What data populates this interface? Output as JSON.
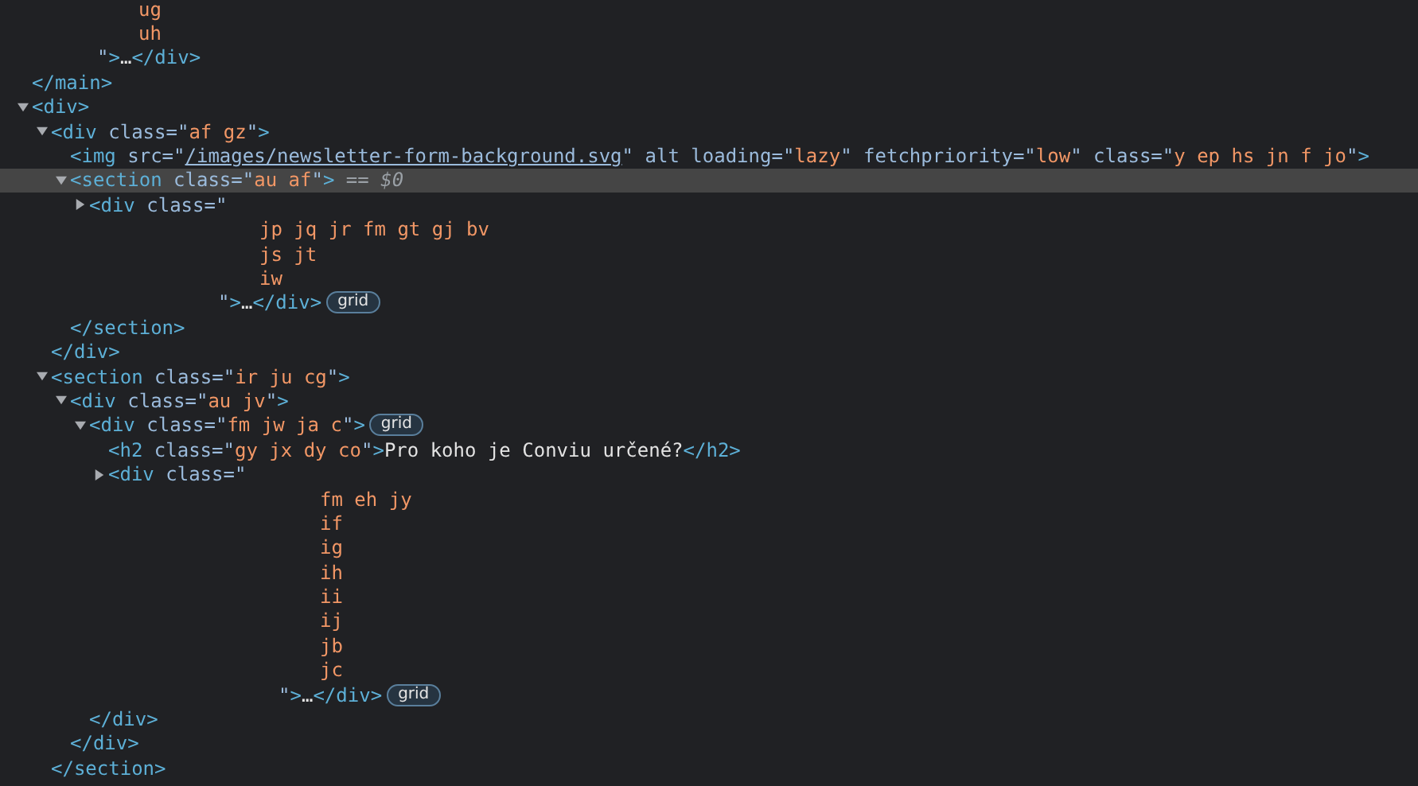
{
  "tree": [
    {
      "selected": false,
      "children": [
        {
          "selected": false,
          "class_lines": [
            "ug",
            "uh"
          ],
          "open_end": [
            {
              "kind": "attr",
              "text": "\""
            },
            {
              "kind": "tag",
              "text": ">"
            },
            {
              "kind": "text",
              "text": "…"
            },
            {
              "kind": "tag",
              "text": "</div>"
            }
          ]
        }
      ],
      "close": [
        {
          "kind": "tag",
          "text": "</main>"
        }
      ]
    },
    {
      "selected": false,
      "expanded": true,
      "open": [
        {
          "kind": "tag",
          "text": "<div>"
        }
      ],
      "children": [
        {
          "selected": false,
          "expanded": true,
          "open": [
            {
              "kind": "tag",
              "text": "<div "
            },
            {
              "kind": "attr",
              "text": "class=\""
            },
            {
              "kind": "value",
              "text": "af gz"
            },
            {
              "kind": "attr",
              "text": "\""
            },
            {
              "kind": "tag",
              "text": ">"
            }
          ],
          "children": [
            {
              "selected": false,
              "open": [
                {
                  "kind": "tag",
                  "text": "<img "
                },
                {
                  "kind": "attr",
                  "text": "src=\""
                },
                {
                  "kind": "link",
                  "text": "/images/newsletter-form-background.svg"
                },
                {
                  "kind": "attr",
                  "text": "\" alt loading=\""
                },
                {
                  "kind": "value",
                  "text": "lazy"
                },
                {
                  "kind": "attr",
                  "text": "\" fetchpriority=\""
                },
                {
                  "kind": "value",
                  "text": "low"
                },
                {
                  "kind": "attr",
                  "text": "\" class=\""
                },
                {
                  "kind": "value",
                  "text": "y ep hs jn f jo"
                },
                {
                  "kind": "attr",
                  "text": "\""
                },
                {
                  "kind": "tag",
                  "text": ">"
                }
              ]
            },
            {
              "selected": true,
              "expanded": true,
              "open": [
                {
                  "kind": "tag",
                  "text": "<section "
                },
                {
                  "kind": "attr",
                  "text": "class=\""
                },
                {
                  "kind": "value",
                  "text": "au af"
                },
                {
                  "kind": "attr",
                  "text": "\""
                },
                {
                  "kind": "tag",
                  "text": ">"
                },
                {
                  "kind": "marker",
                  "text": " == $0"
                }
              ],
              "children": [
                {
                  "selected": false,
                  "expanded": false,
                  "open": [
                    {
                      "kind": "tag",
                      "text": "<div "
                    },
                    {
                      "kind": "attr",
                      "text": "class=\""
                    }
                  ],
                  "class_lines": [
                    "jp jq jr fm gt gj bv",
                    "js jt",
                    "iw"
                  ],
                  "open_end": [
                    {
                      "kind": "attr",
                      "text": "\""
                    },
                    {
                      "kind": "tag",
                      "text": ">"
                    },
                    {
                      "kind": "text",
                      "text": "…"
                    },
                    {
                      "kind": "tag",
                      "text": "</div>"
                    }
                  ],
                  "badge": "grid"
                }
              ],
              "close": [
                {
                  "kind": "tag",
                  "text": "</section>"
                }
              ]
            }
          ],
          "close": [
            {
              "kind": "tag",
              "text": "</div>"
            }
          ]
        },
        {
          "selected": false,
          "expanded": true,
          "open": [
            {
              "kind": "tag",
              "text": "<section "
            },
            {
              "kind": "attr",
              "text": "class=\""
            },
            {
              "kind": "value",
              "text": "ir ju cg"
            },
            {
              "kind": "attr",
              "text": "\""
            },
            {
              "kind": "tag",
              "text": ">"
            }
          ],
          "children": [
            {
              "selected": false,
              "expanded": true,
              "open": [
                {
                  "kind": "tag",
                  "text": "<div "
                },
                {
                  "kind": "attr",
                  "text": "class=\""
                },
                {
                  "kind": "value",
                  "text": "au jv"
                },
                {
                  "kind": "attr",
                  "text": "\""
                },
                {
                  "kind": "tag",
                  "text": ">"
                }
              ],
              "children": [
                {
                  "selected": false,
                  "expanded": true,
                  "open": [
                    {
                      "kind": "tag",
                      "text": "<div "
                    },
                    {
                      "kind": "attr",
                      "text": "class=\""
                    },
                    {
                      "kind": "value",
                      "text": "fm jw ja c"
                    },
                    {
                      "kind": "attr",
                      "text": "\""
                    },
                    {
                      "kind": "tag",
                      "text": ">"
                    }
                  ],
                  "badge": "grid",
                  "children": [
                    {
                      "selected": false,
                      "open": [
                        {
                          "kind": "tag",
                          "text": "<h2 "
                        },
                        {
                          "kind": "attr",
                          "text": "class=\""
                        },
                        {
                          "kind": "value",
                          "text": "gy jx dy co"
                        },
                        {
                          "kind": "attr",
                          "text": "\""
                        },
                        {
                          "kind": "tag",
                          "text": ">"
                        },
                        {
                          "kind": "text",
                          "text": "Pro koho je Conviu určené?"
                        },
                        {
                          "kind": "tag",
                          "text": "</h2>"
                        }
                      ]
                    },
                    {
                      "selected": false,
                      "expanded": false,
                      "open": [
                        {
                          "kind": "tag",
                          "text": "<div "
                        },
                        {
                          "kind": "attr",
                          "text": "class=\""
                        }
                      ],
                      "class_lines": [
                        "fm eh jy",
                        "if",
                        "ig",
                        "ih",
                        "ii",
                        "ij",
                        "jb",
                        "jc"
                      ],
                      "open_end": [
                        {
                          "kind": "attr",
                          "text": "\""
                        },
                        {
                          "kind": "tag",
                          "text": ">"
                        },
                        {
                          "kind": "text",
                          "text": "…"
                        },
                        {
                          "kind": "tag",
                          "text": "</div>"
                        }
                      ],
                      "badge": "grid"
                    }
                  ],
                  "close": [
                    {
                      "kind": "tag",
                      "text": "</div>"
                    }
                  ]
                }
              ],
              "close": [
                {
                  "kind": "tag",
                  "text": "</div>"
                }
              ]
            }
          ],
          "close": [
            {
              "kind": "tag",
              "text": "</section>"
            }
          ]
        }
      ]
    }
  ]
}
